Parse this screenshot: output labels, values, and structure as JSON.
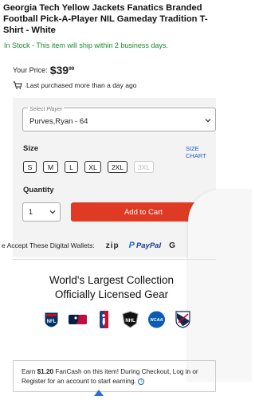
{
  "product": {
    "title": "Georgia Tech Yellow Jackets Fanatics Branded Football Pick-A-Player NIL Gameday Tradition T-Shirt - White",
    "stock": "In Stock - This item will ship within 2 business days.",
    "price_label": "Your Price:",
    "price_dollars": "$39",
    "price_cents": "99",
    "last_purchased": "Last purchased more than a day ago"
  },
  "player_select": {
    "legend": "Select Player",
    "value": "Purves,Ryan - 64"
  },
  "size": {
    "label": "Size",
    "chart_link": "SIZE CHART",
    "options": [
      "S",
      "M",
      "L",
      "XL",
      "2XL",
      "3XL"
    ],
    "disabled": [
      "3XL"
    ]
  },
  "quantity": {
    "label": "Quantity",
    "value": "1"
  },
  "add_to_cart": "Add to Cart",
  "wallets": {
    "label": "e Accept These Digital Wallets:",
    "zip": "zip",
    "paypal": "PayPal",
    "extra": "G"
  },
  "headline": {
    "line1": "World's Largest Collection",
    "line2": "Officially Licensed Gear"
  },
  "league_logos": [
    "nfl-logo",
    "mlb-logo",
    "nba-logo",
    "nhl-logo",
    "ncaa-logo",
    "mls-logo"
  ],
  "fancash": {
    "pre": "Earn ",
    "amount": "$1.20",
    "post": " FanCash on this item! During Checkout, Log in or Register for an account to start earning."
  },
  "colors": {
    "accent_red": "#de3a24",
    "stock_green": "#1a8a2a",
    "link_blue": "#1a5fc0"
  }
}
